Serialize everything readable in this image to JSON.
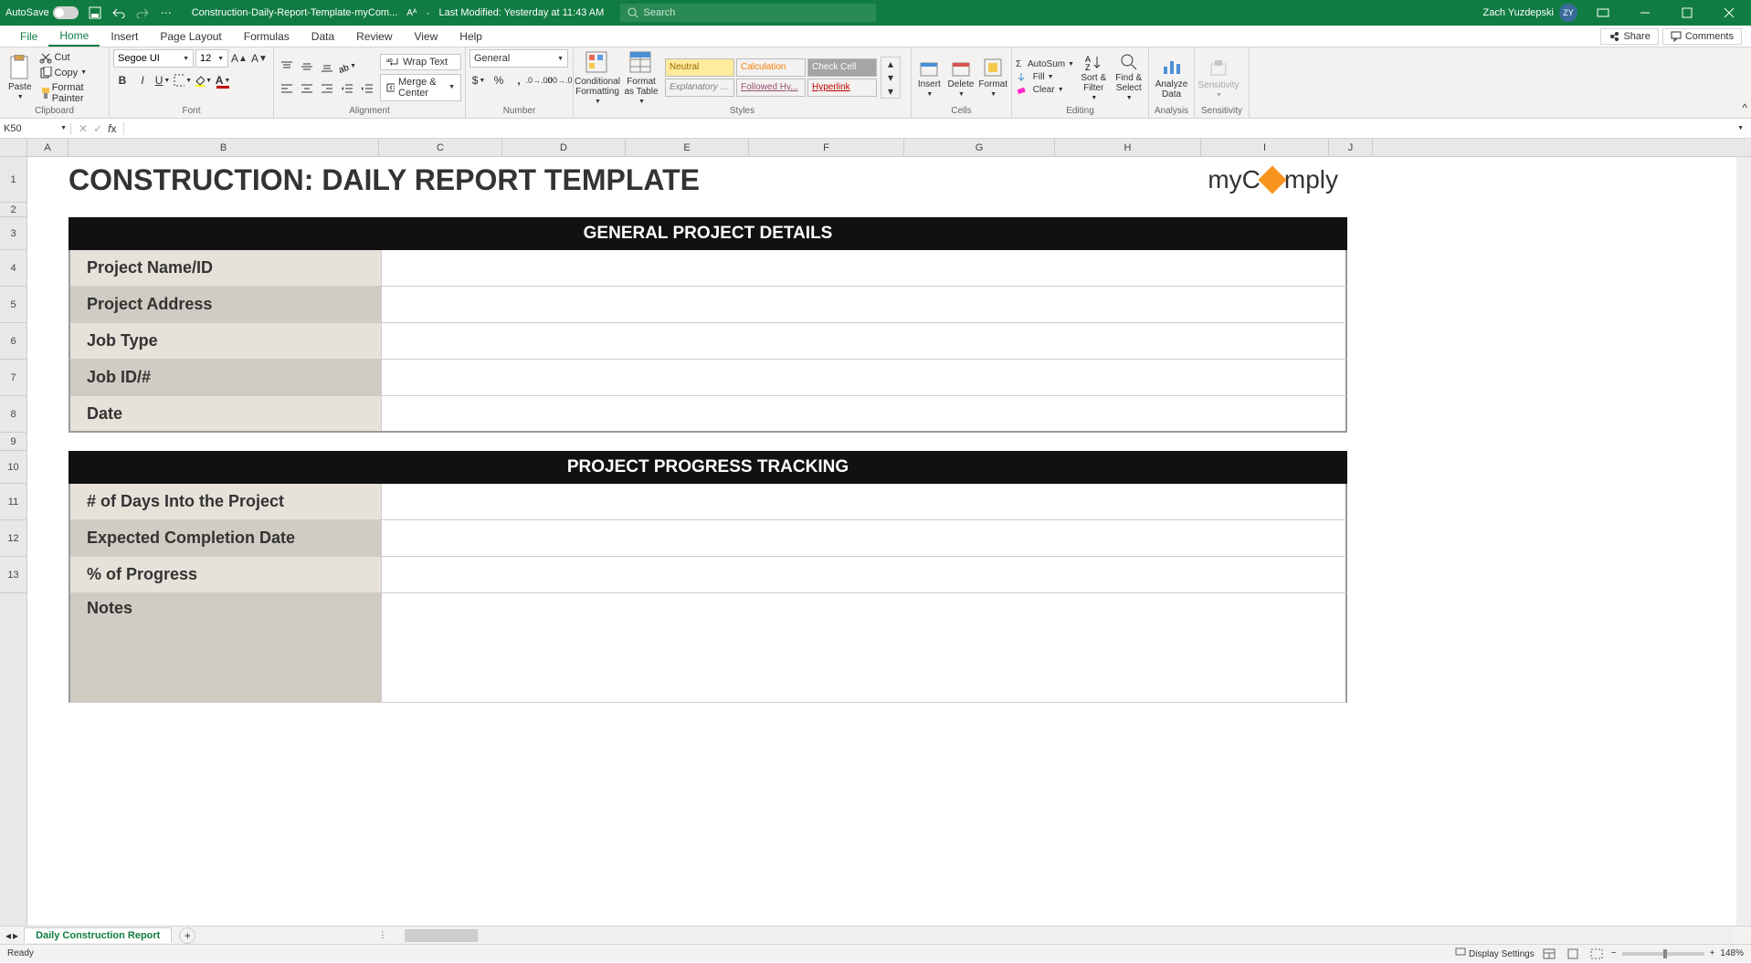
{
  "titlebar": {
    "autosave": "AutoSave",
    "filename": "Construction-Daily-Report-Template-myCom...",
    "modified": "Last Modified: Yesterday at 11:43 AM",
    "search_placeholder": "Search",
    "user": "Zach Yuzdepski",
    "initials": "ZY"
  },
  "tabs": {
    "file": "File",
    "home": "Home",
    "insert": "Insert",
    "pagelayout": "Page Layout",
    "formulas": "Formulas",
    "data": "Data",
    "review": "Review",
    "view": "View",
    "help": "Help",
    "share": "Share",
    "comments": "Comments"
  },
  "ribbon": {
    "clipboard": {
      "paste": "Paste",
      "cut": "Cut",
      "copy": "Copy",
      "fp": "Format Painter",
      "label": "Clipboard"
    },
    "font": {
      "name": "Segoe UI",
      "size": "12",
      "label": "Font"
    },
    "alignment": {
      "wrap": "Wrap Text",
      "merge": "Merge & Center",
      "label": "Alignment"
    },
    "number": {
      "format": "General",
      "label": "Number"
    },
    "styles": {
      "cond": "Conditional Formatting",
      "table": "Format as Table",
      "neutral": "Neutral",
      "calc": "Calculation",
      "check": "Check Cell",
      "explan": "Explanatory ...",
      "follow": "Followed Hy...",
      "hyper": "Hyperlink",
      "label": "Styles"
    },
    "cells": {
      "insert": "Insert",
      "delete": "Delete",
      "format": "Format",
      "label": "Cells"
    },
    "editing": {
      "autosum": "AutoSum",
      "fill": "Fill",
      "clear": "Clear",
      "sort": "Sort & Filter",
      "find": "Find & Select",
      "label": "Editing"
    },
    "analysis": {
      "analyze": "Analyze Data",
      "label": "Analysis"
    },
    "sensitivity": {
      "btn": "Sensitivity",
      "label": "Sensitivity"
    }
  },
  "namebox": "K50",
  "columns": [
    "A",
    "B",
    "C",
    "D",
    "E",
    "F",
    "G",
    "H",
    "I",
    "J"
  ],
  "rows": [
    "1",
    "2",
    "3",
    "4",
    "5",
    "6",
    "7",
    "8",
    "9",
    "10",
    "11",
    "12",
    "13"
  ],
  "doc": {
    "title": "CONSTRUCTION: DAILY REPORT TEMPLATE",
    "logo1": "myC",
    "logo2": "mply",
    "section1": "GENERAL PROJECT DETAILS",
    "fields1": {
      "a": "Project Name/ID",
      "b": "Project Address",
      "c": "Job Type",
      "d": "Job ID/#",
      "e": "Date"
    },
    "section2": "PROJECT PROGRESS TRACKING",
    "fields2": {
      "a": "# of Days Into the Project",
      "b": "Expected Completion Date",
      "c": "% of Progress",
      "d": "Notes"
    }
  },
  "sheettab": "Daily Construction Report",
  "status": {
    "ready": "Ready",
    "display": "Display Settings",
    "zoom": "148%"
  }
}
